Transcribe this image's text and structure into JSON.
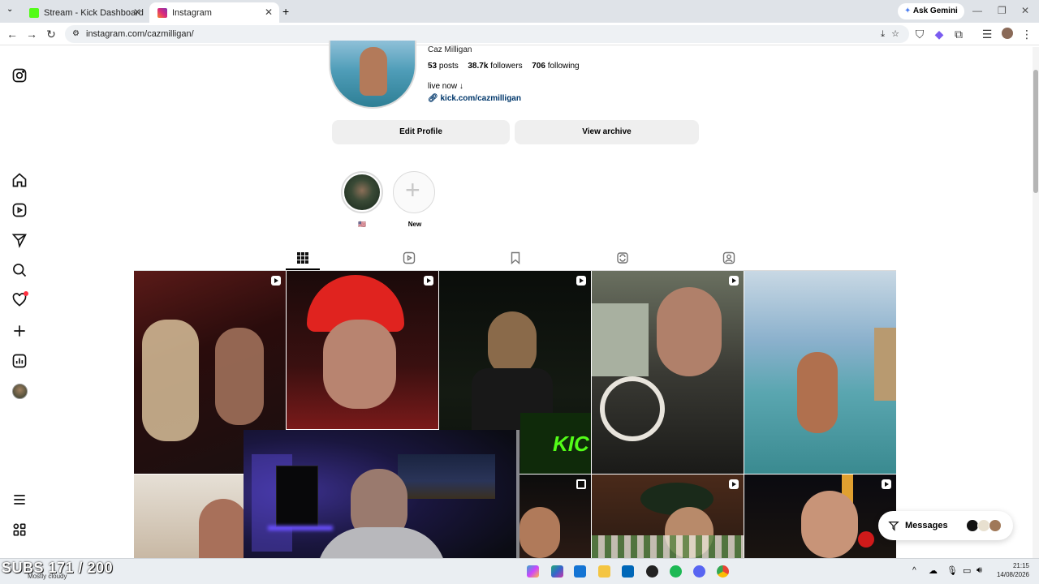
{
  "browser": {
    "tabs": [
      {
        "title": "Stream - Kick Dashboard",
        "active": false
      },
      {
        "title": "Instagram",
        "active": true
      }
    ],
    "url": "instagram.com/cazmilligan/",
    "ask_gemini": "Ask Gemini"
  },
  "profile": {
    "name": "Caz Milligan",
    "posts_count": "53",
    "posts_label": "posts",
    "followers_count": "38.7k",
    "followers_label": "followers",
    "following_count": "706",
    "following_label": "following",
    "bio": "live now ↓",
    "link": "kick.com/cazmilligan"
  },
  "actions": {
    "edit_profile": "Edit Profile",
    "view_archive": "View archive"
  },
  "highlights": [
    {
      "label": "🇺🇸"
    },
    {
      "label": "New"
    }
  ],
  "messages": {
    "label": "Messages"
  },
  "overlay": {
    "subs": "SUBS 171 / 200"
  },
  "taskbar": {
    "weather": "Mostly cloudy",
    "time": "21:15",
    "date": "14/08/2026"
  },
  "colors": {
    "kick_green": "#53fc18",
    "instagram_gradient_start": "#f58529",
    "accent_link": "#00376b"
  }
}
